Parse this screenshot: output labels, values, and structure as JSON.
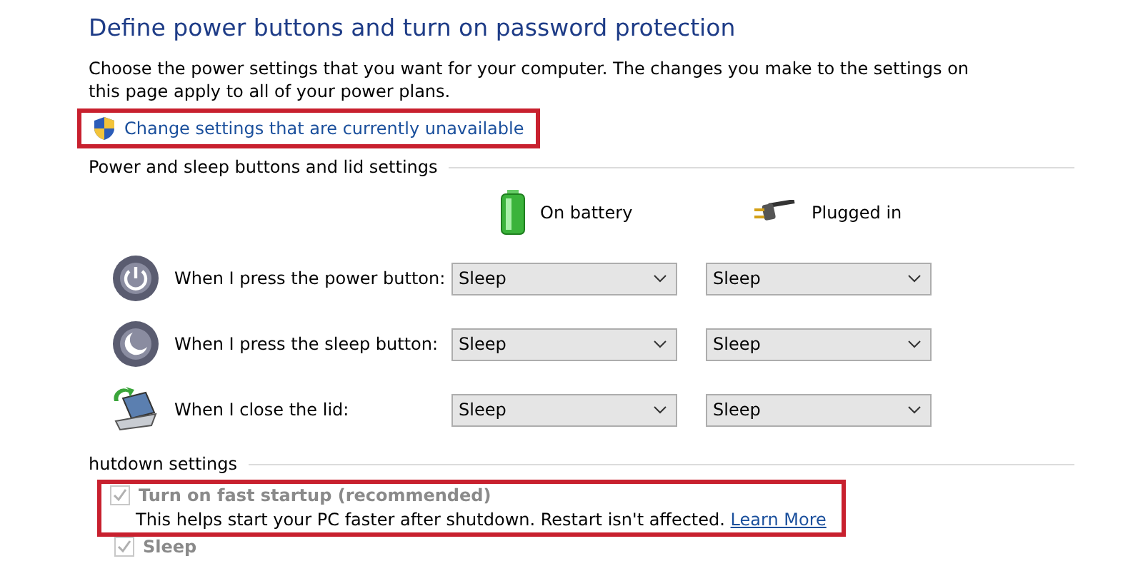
{
  "title": "Define power buttons and turn on password protection",
  "description": "Choose the power settings that you want for your computer. The changes you make to the settings on this page apply to all of your power plans.",
  "admin_link": {
    "label": "Change settings that are currently unavailable",
    "highlighted": true
  },
  "buttons_section": {
    "heading": "Power and sleep buttons and lid settings",
    "columns": [
      {
        "kind": "battery",
        "label": "On battery"
      },
      {
        "kind": "plug",
        "label": "Plugged in"
      }
    ],
    "rows": [
      {
        "kind": "power",
        "label": "When I press the power button:",
        "values": [
          "Sleep",
          "Sleep"
        ]
      },
      {
        "kind": "sleep",
        "label": "When I press the sleep button:",
        "values": [
          "Sleep",
          "Sleep"
        ]
      },
      {
        "kind": "lid",
        "label": "When I close the lid:",
        "values": [
          "Sleep",
          "Sleep"
        ]
      }
    ]
  },
  "shutdown_section": {
    "heading": "hutdown settings",
    "fast_startup": {
      "label": "Turn on fast startup (recommended)",
      "checked": true,
      "disabled": true,
      "highlighted": true,
      "note": "This helps start your PC faster after shutdown. Restart isn't affected.",
      "link": "Learn More"
    },
    "sleep": {
      "label": "Sleep",
      "checked": true,
      "disabled": true
    }
  }
}
